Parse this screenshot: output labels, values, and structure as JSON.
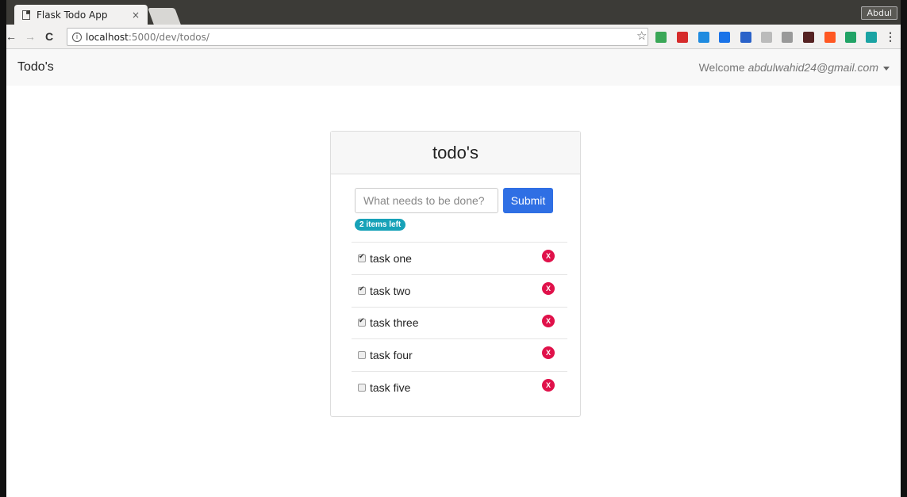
{
  "browser": {
    "tab_title": "Flask Todo App",
    "tab_close": "×",
    "user": "Abdul",
    "url_host": "localhost",
    "url_path": ":5000/dev/todos/",
    "info_glyph": "i",
    "back": "←",
    "forward": "→",
    "reload": "C",
    "star": "☆",
    "menu": "⋮"
  },
  "navbar": {
    "brand": "Todo's",
    "welcome_prefix": "Welcome ",
    "email": "abdulwahid24@gmail.com"
  },
  "card": {
    "title": "todo's",
    "input_placeholder": "What needs to be done?",
    "submit_label": "Submit",
    "items_left": "2 items left"
  },
  "todos": [
    {
      "text": "task one",
      "done": true
    },
    {
      "text": "task two",
      "done": true
    },
    {
      "text": "task three",
      "done": true
    },
    {
      "text": "task four",
      "done": false
    },
    {
      "text": "task five",
      "done": false
    }
  ],
  "delete_label": "X",
  "extension_colors": [
    "#3aa757",
    "#d62b2b",
    "#1f8be0",
    "#1a73e8",
    "#2a62c9",
    "#bbbbbb",
    "#999999",
    "#552222",
    "#ff5722",
    "#21a366",
    "#1aa3a3"
  ]
}
